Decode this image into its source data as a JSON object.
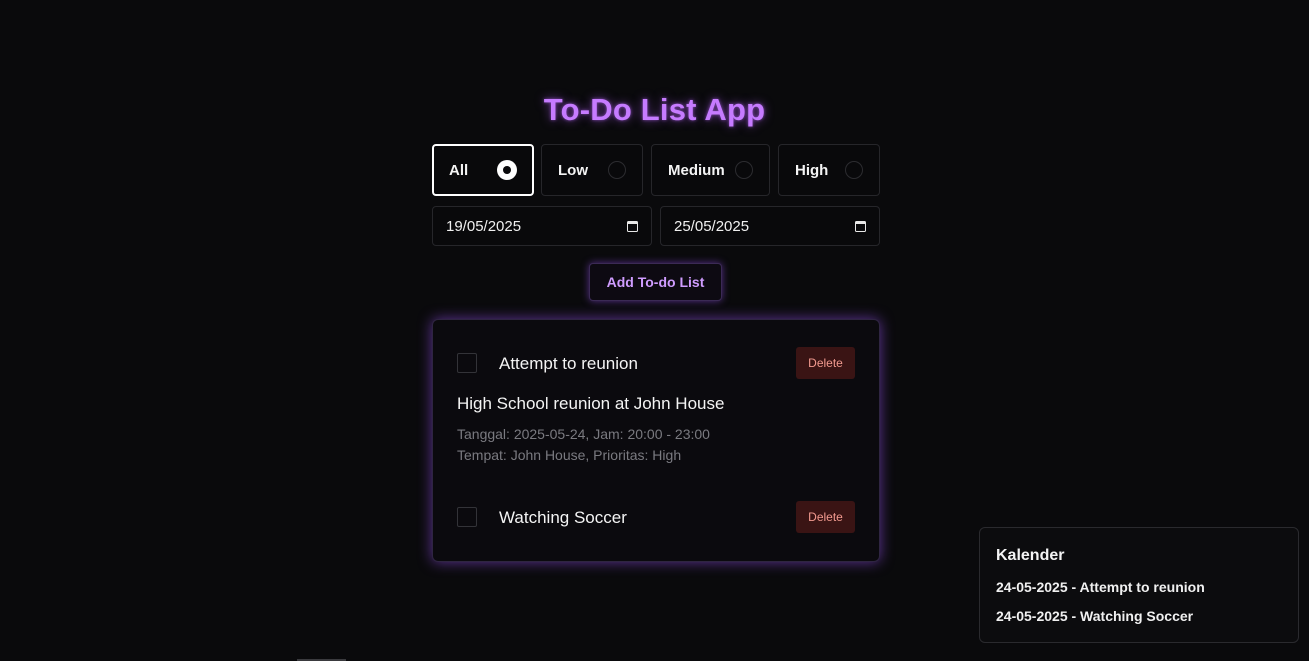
{
  "app": {
    "title": "To-Do List App",
    "accent_color": "#c67bff"
  },
  "filters": [
    {
      "label": "All",
      "selected": true
    },
    {
      "label": "Low",
      "selected": false
    },
    {
      "label": "Medium",
      "selected": false
    },
    {
      "label": "High",
      "selected": false
    }
  ],
  "date_range": {
    "start": "19/05/2025",
    "end": "25/05/2025",
    "icon": "calendar-icon"
  },
  "add_button": {
    "label": "Add To-do List"
  },
  "todos": [
    {
      "title": "Attempt to reunion",
      "checked": false,
      "description": "High School reunion at John House",
      "meta_line1": "Tanggal: 2025-05-24, Jam: 20:00 - 23:00",
      "meta_line2": "Tempat: John House, Prioritas: High",
      "delete_label": "Delete"
    },
    {
      "title": "Watching Soccer",
      "checked": false,
      "delete_label": "Delete"
    }
  ],
  "calendar": {
    "title": "Kalender",
    "entries": [
      "24-05-2025 - Attempt to reunion",
      "24-05-2025 - Watching Soccer"
    ]
  }
}
